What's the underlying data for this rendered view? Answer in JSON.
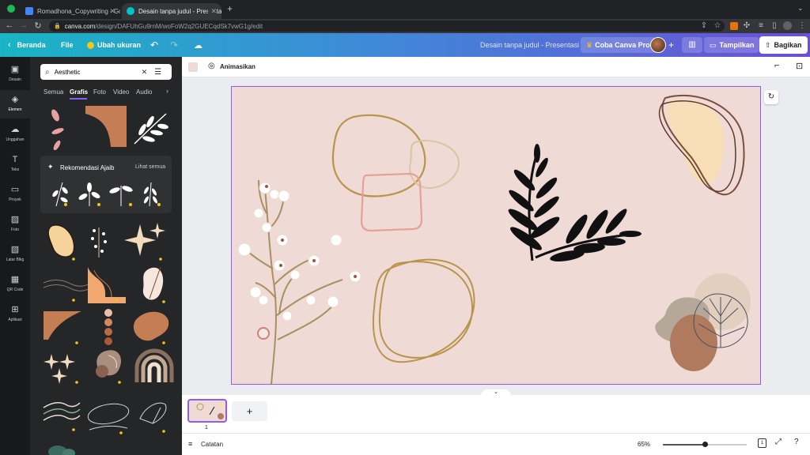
{
  "browser": {
    "tabs": [
      {
        "title": "Romadhona_Copywriting - Goo"
      },
      {
        "title": "Desain tanpa judul - Presentasi"
      }
    ],
    "new_tab": "+",
    "url_host": "canva.com",
    "url_path": "/design/DAFUhGu9rnM/woFoW2q2GUECqdSk7vwG1g/edit"
  },
  "topbar": {
    "back_label": "Beranda",
    "file_label": "File",
    "resize_label": "Ubah ukuran",
    "doc_title": "Desain tanpa judul - Presentasi",
    "pro_label": "Coba Canva Pro",
    "present_label": "Tampilkan",
    "share_label": "Bagikan"
  },
  "rail": {
    "items": [
      {
        "label": "Desain",
        "icon": "layout-icon"
      },
      {
        "label": "Elemen",
        "icon": "shapes-icon"
      },
      {
        "label": "Unggahan",
        "icon": "cloud-upload-icon"
      },
      {
        "label": "Teks",
        "icon": "text-icon"
      },
      {
        "label": "Proyek",
        "icon": "folder-icon"
      },
      {
        "label": "Foto",
        "icon": "photo-icon"
      },
      {
        "label": "Latar Blkg",
        "icon": "pattern-icon"
      },
      {
        "label": "QR Code",
        "icon": "qr-icon"
      },
      {
        "label": "Aplikasi",
        "icon": "apps-icon"
      }
    ]
  },
  "panel": {
    "search_value": "Aesthetic",
    "tabs": [
      "Semua",
      "Grafis",
      "Foto",
      "Video",
      "Audio"
    ],
    "active_tab": "Grafis",
    "rec_title": "Rekomendasi Ajaib",
    "rec_link": "Lihat semua"
  },
  "editor": {
    "animate_label": "Animasikan",
    "page_number": "1",
    "notes_label": "Catatan",
    "zoom": "65%",
    "page_count": "1",
    "zoom_fraction": 0.5
  },
  "colors": {
    "canvas_bg": "#efdad6",
    "gold": "#b8954a",
    "brown": "#6e4a35",
    "peach": "#f7deb6",
    "salmon": "#e5a294",
    "selection": "#8b5cf6"
  }
}
